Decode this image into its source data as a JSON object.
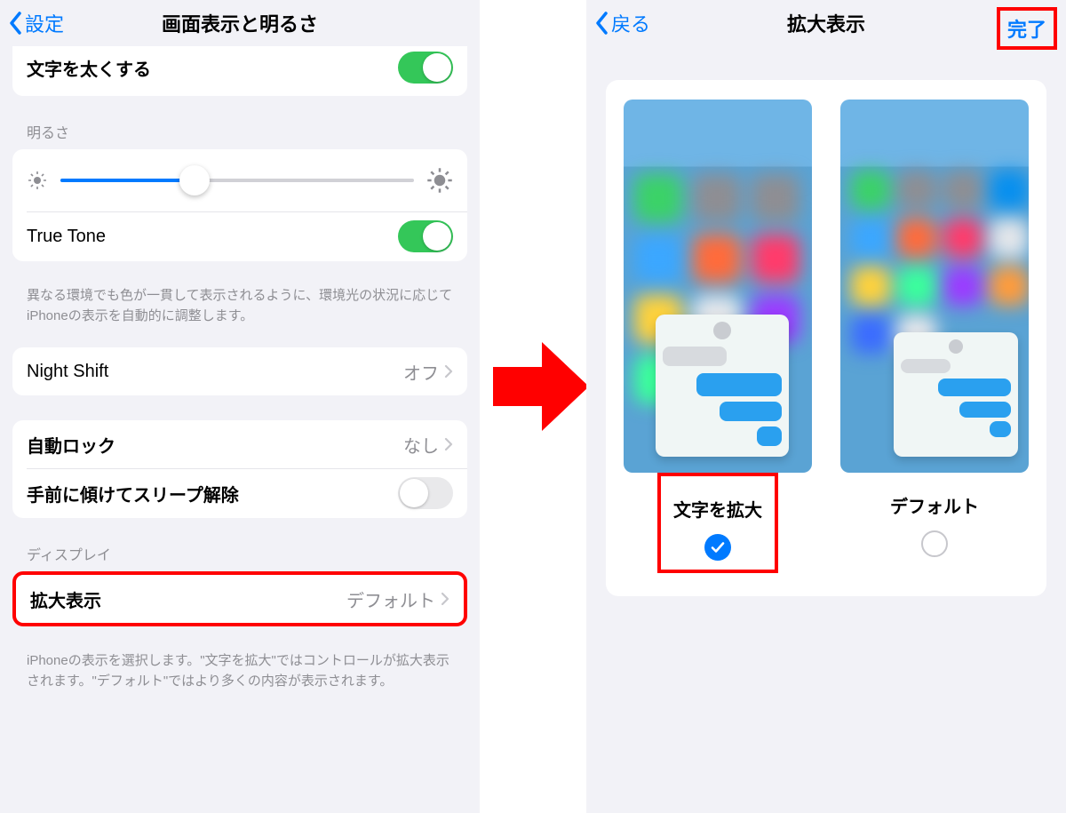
{
  "left": {
    "nav": {
      "back": "設定",
      "title": "画面表示と明るさ"
    },
    "bold_text_row": {
      "label": "文字を太くする"
    },
    "brightness": {
      "header": "明るさ"
    },
    "true_tone": {
      "label": "True Tone",
      "note": "異なる環境でも色が一貫して表示されるように、環境光の状況に応じてiPhoneの表示を自動的に調整します。"
    },
    "night_shift": {
      "label": "Night Shift",
      "value": "オフ"
    },
    "auto_lock": {
      "label": "自動ロック",
      "value": "なし"
    },
    "raise_to_wake": {
      "label": "手前に傾けてスリープ解除"
    },
    "display_header": "ディスプレイ",
    "zoom": {
      "label": "拡大表示",
      "value": "デフォルト"
    },
    "zoom_note": "iPhoneの表示を選択します。\"文字を拡大\"ではコントロールが拡大表示されます。\"デフォルト\"ではより多くの内容が表示されます。"
  },
  "right": {
    "nav": {
      "back": "戻る",
      "title": "拡大表示",
      "done": "完了"
    },
    "choices": {
      "zoomed": "文字を拡大",
      "standard": "デフォルト"
    }
  }
}
